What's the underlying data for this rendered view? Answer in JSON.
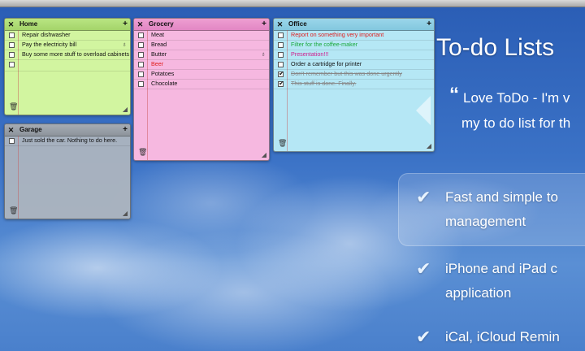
{
  "notes": {
    "home": {
      "title": "Home",
      "close": "✕",
      "add": "+",
      "items": [
        {
          "text": "Repair dishwasher",
          "done": false
        },
        {
          "text": "Pay the electricity bill",
          "done": false
        },
        {
          "text": "Buy some more stuff to overload cabinets",
          "done": false
        },
        {
          "text": "",
          "done": false
        }
      ]
    },
    "garage": {
      "title": "Garage",
      "close": "✕",
      "add": "+",
      "items": [
        {
          "text": "Just sold the car. Nothing to do here.",
          "done": false
        }
      ]
    },
    "grocery": {
      "title": "Grocery",
      "close": "✕",
      "add": "+",
      "items": [
        {
          "text": "Meat",
          "done": false,
          "color": ""
        },
        {
          "text": "Bread",
          "done": false,
          "color": ""
        },
        {
          "text": "Butter",
          "done": false,
          "color": ""
        },
        {
          "text": "Beer",
          "done": false,
          "color": "#e02020"
        },
        {
          "text": "Potatoes",
          "done": false,
          "color": ""
        },
        {
          "text": "Chocolate",
          "done": false,
          "color": ""
        }
      ]
    },
    "office": {
      "title": "Office",
      "close": "✕",
      "add": "+",
      "items": [
        {
          "text": "Report on something very important",
          "done": false,
          "color": "#e02020"
        },
        {
          "text": "Filter for the coffee-maker",
          "done": false,
          "color": "#1aa83a"
        },
        {
          "text": "Presentation!!!",
          "done": false,
          "color": "#d01a8a"
        },
        {
          "text": "Order a cartridge for printer",
          "done": false,
          "color": ""
        },
        {
          "text": "Don't remember but this was done urgently",
          "done": true,
          "color": ""
        },
        {
          "text": "This stuff is done. Finally.",
          "done": true,
          "color": ""
        }
      ]
    }
  },
  "icons": {
    "trash": "🗑",
    "grip": "◢",
    "flag": "♁"
  },
  "promo": {
    "title": "To-do Lists",
    "quote_mark": "“",
    "quote_line1": "Love ToDo - I'm v",
    "quote_line2": "my to do list for th",
    "features": [
      {
        "line1": "Fast and simple to",
        "line2": "management"
      },
      {
        "line1": "iPhone and iPad c",
        "line2": "application"
      },
      {
        "line1": "iCal, iCloud Remin",
        "line2": ""
      }
    ]
  }
}
